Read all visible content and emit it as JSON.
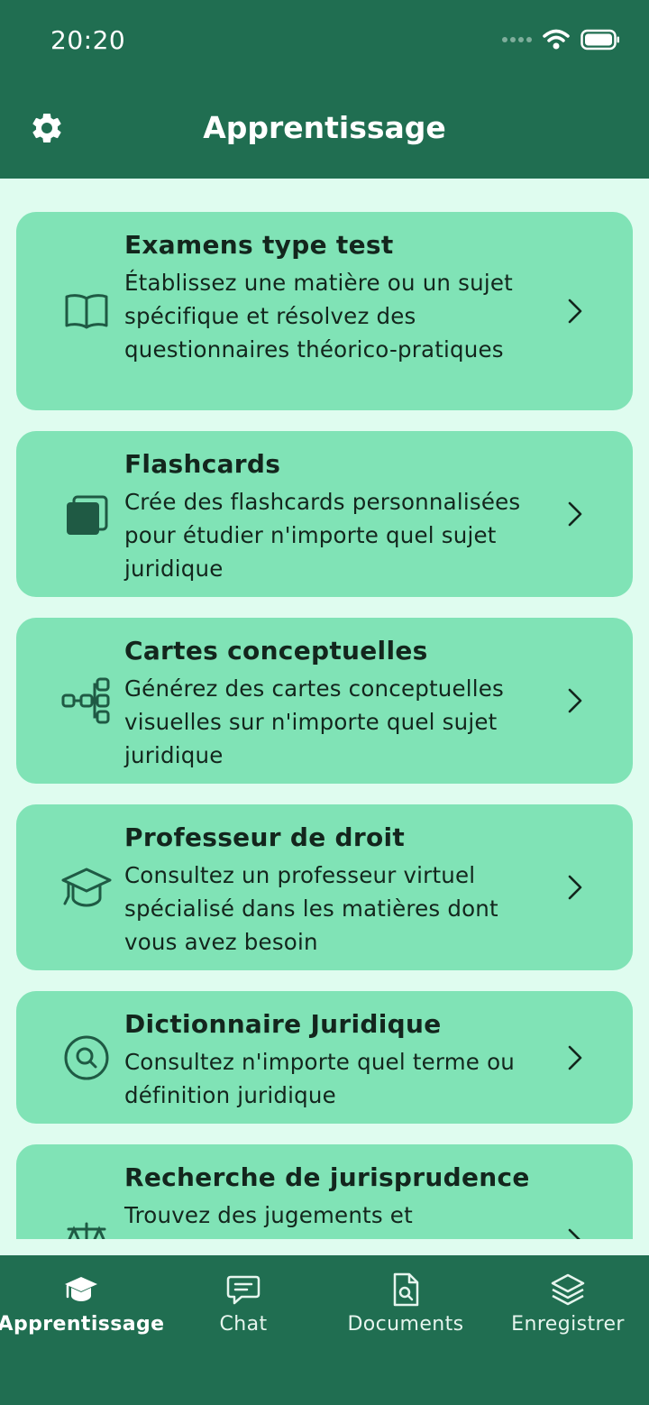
{
  "status": {
    "time": "20:20"
  },
  "header": {
    "title": "Apprentissage"
  },
  "cards": [
    {
      "title": "Examens type test",
      "description": "Établissez une matière ou un sujet spécifique et résolvez des questionnaires théorico-pratiques",
      "icon": "book-icon"
    },
    {
      "title": "Flashcards",
      "description": "Crée des flashcards personnalisées pour étudier n'importe quel sujet juridique",
      "icon": "flashcards-icon"
    },
    {
      "title": "Cartes conceptuelles",
      "description": "Générez des cartes conceptuelles visuelles sur n'importe quel sujet juridique",
      "icon": "mind-map-icon"
    },
    {
      "title": "Professeur de droit",
      "description": "Consultez un professeur virtuel spécialisé dans les matières dont vous avez besoin",
      "icon": "graduation-cap-icon"
    },
    {
      "title": "Dictionnaire Juridique",
      "description": "Consultez n'importe quel terme ou définition juridique",
      "icon": "search-circle-icon"
    },
    {
      "title": "Recherche de jurisprudence",
      "description": "Trouvez des jugements et",
      "icon": "scales-icon"
    }
  ],
  "tabs": [
    {
      "label": "Apprentissage",
      "icon": "graduation-cap-icon",
      "active": true
    },
    {
      "label": "Chat",
      "icon": "chat-icon",
      "active": false
    },
    {
      "label": "Documents",
      "icon": "document-search-icon",
      "active": false
    },
    {
      "label": "Enregistrer",
      "icon": "layers-icon",
      "active": false
    }
  ],
  "colors": {
    "primary": "#206e51",
    "card": "#80e3b6",
    "background": "#dffcef",
    "text": "#13261d"
  }
}
